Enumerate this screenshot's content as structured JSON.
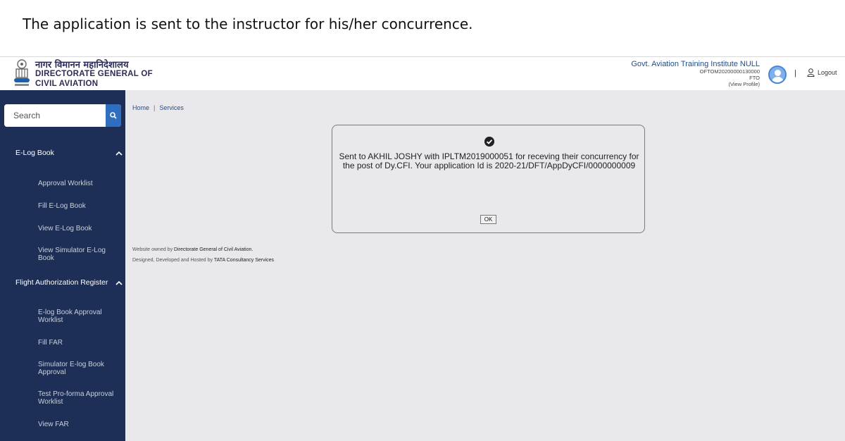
{
  "caption": "The application is sent to the instructor for his/her concurrence.",
  "header": {
    "logo_hindi": "नागर विमानन महानिदेशालय",
    "logo_line1": "DIRECTORATE GENERAL OF",
    "logo_line2": "CIVIL AVIATION",
    "user_name": "Govt. Aviation Training Institute NULL",
    "user_id": "OFTOM20200000130000",
    "user_role": "FTO",
    "view_profile": "(View Profile)",
    "separator": "|",
    "logout_label": "Logout"
  },
  "search": {
    "placeholder": "Search"
  },
  "sidebar": {
    "section1": {
      "label": "E-Log Book",
      "items": [
        "Approval Worklist",
        "Fill E-Log Book",
        "View E-Log Book",
        "View Simulator E-Log Book"
      ]
    },
    "section2": {
      "label": "Flight Authorization Register",
      "items": [
        "E-log Book Approval Worklist",
        "Fill FAR",
        "Simulator E-log Book Approval",
        "Test Pro-forma Approval Worklist",
        "View FAR"
      ]
    }
  },
  "breadcrumb": {
    "home": "Home",
    "sep": "|",
    "services": "Services"
  },
  "footer": {
    "line1_prefix": "Website owned by",
    "line1_org": "Directorate General of Civil Aviation.",
    "line2_prefix": "Designed, Developed and Hosted by",
    "line2_org": "TATA Consultancy Services"
  },
  "dialog": {
    "message": "Sent to AKHIL JOSHY with IPLTM2019000051 for receving their concurrency for the post of Dy.CFI. Your application Id is 2020-21/DFT/AppDyCFI/0000000009",
    "ok_label": "OK"
  },
  "colors": {
    "sidebar_bg": "#1d2f56",
    "search_button": "#2e6fc0",
    "content_bg": "#e9e9ed",
    "link": "#1f4e8c"
  }
}
